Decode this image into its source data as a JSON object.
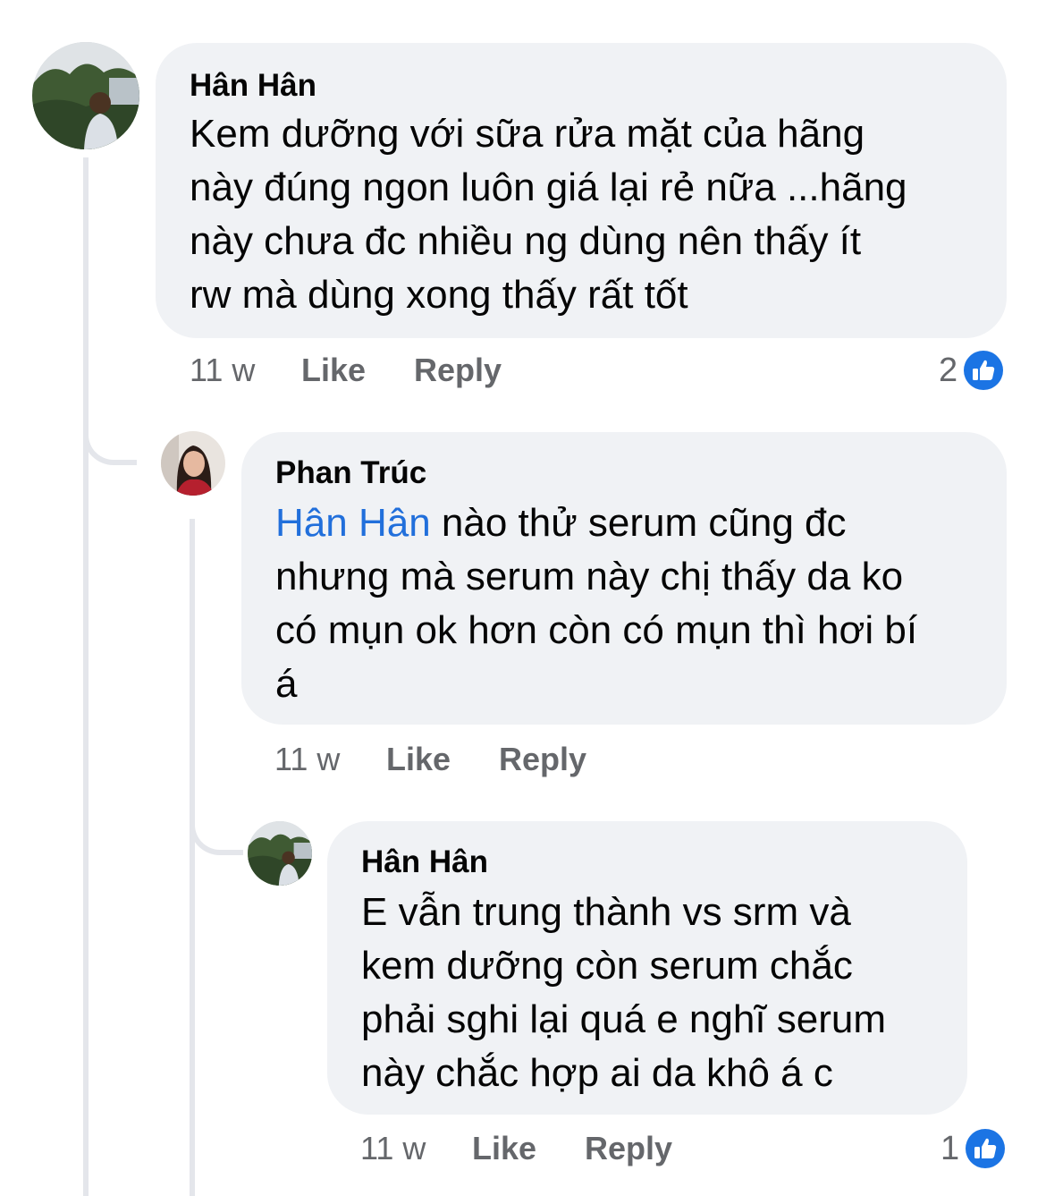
{
  "comments": [
    {
      "author": "Hân Hân",
      "lines": [
        "Kem dưỡng với sữa rửa mặt của hãng",
        "này đúng ngon luôn giá lại rẻ nữa ...hãng",
        "này chưa đc nhiều ng dùng nên  thấy ít",
        "rw mà dùng xong thấy rất tốt"
      ],
      "time": "11 w",
      "like_label": "Like",
      "reply_label": "Reply",
      "reaction_count": "2",
      "avatar_icon": "landscape-avatar"
    },
    {
      "author": "Phan Trúc",
      "mention": "Hân Hân",
      "first_line_rest": " nào thử serum cũng đc",
      "lines": [
        "nhưng mà serum này chị thấy da ko",
        "có mụn ok hơn còn có mụn thì hơi bí",
        "á"
      ],
      "time": "11 w",
      "like_label": "Like",
      "reply_label": "Reply",
      "avatar_icon": "portrait-avatar"
    },
    {
      "author": "Hân Hân",
      "lines": [
        "E vẫn trung thành vs srm và",
        "kem dưỡng còn serum chắc",
        "phải sghi lại quá e nghĩ serum",
        "này chắc hợp ai da khô á c"
      ],
      "time": "11 w",
      "like_label": "Like",
      "reply_label": "Reply",
      "reaction_count": "1",
      "avatar_icon": "landscape-avatar"
    }
  ],
  "colors": {
    "bubble": "#f0f2f5",
    "text": "#050505",
    "secondary": "#65676b",
    "mention": "#216fdb",
    "like_blue": "#1b74e4",
    "thread_line": "#e4e6eb"
  },
  "icons": {
    "reaction": "thumbs-up-icon"
  }
}
